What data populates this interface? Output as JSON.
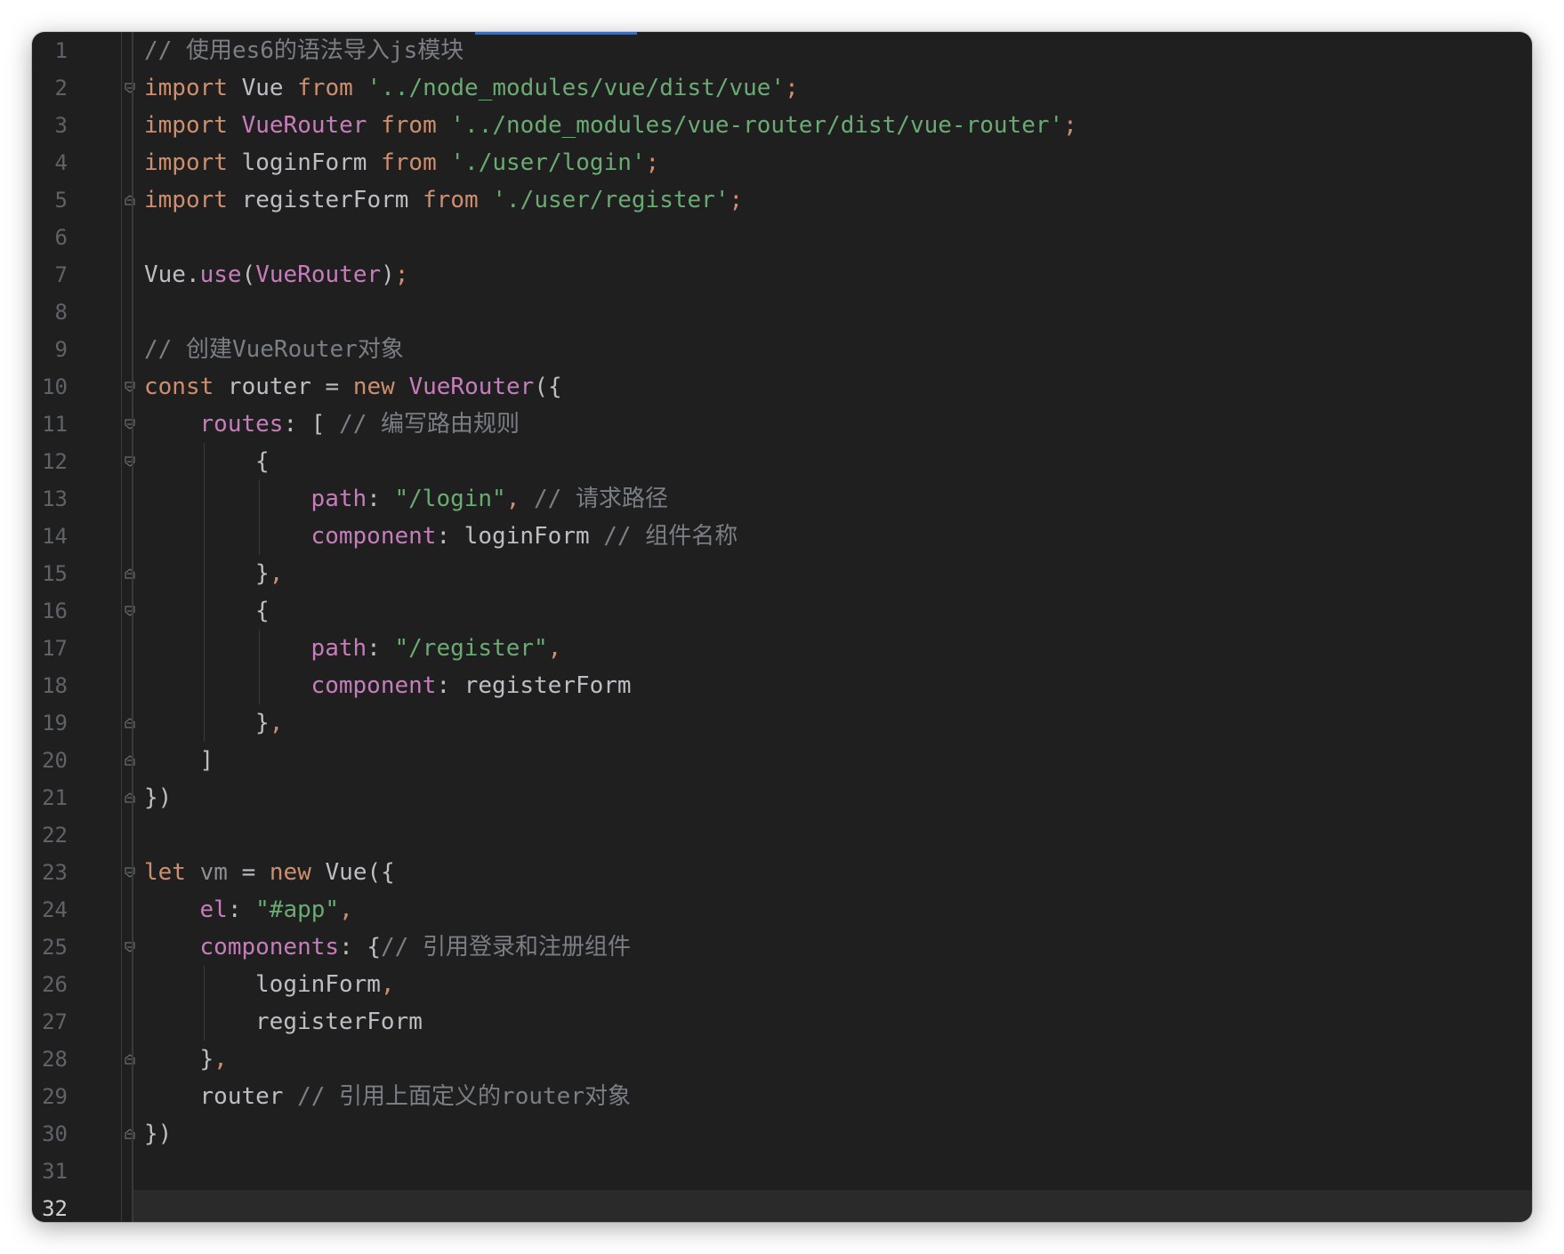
{
  "editor": {
    "current_line": 32,
    "lines": [
      {
        "n": "1",
        "indent": 0,
        "fold": "",
        "tokens": [
          [
            "cmt",
            "// 使用es6的语法导入js模块"
          ]
        ]
      },
      {
        "n": "2",
        "indent": 0,
        "fold": "open",
        "tokens": [
          [
            "kw",
            "import"
          ],
          [
            "plain",
            " Vue "
          ],
          [
            "kw",
            "from"
          ],
          [
            "plain",
            " "
          ],
          [
            "str",
            "'../node_modules/vue/dist/vue'"
          ],
          [
            "punc",
            ";"
          ]
        ]
      },
      {
        "n": "3",
        "indent": 0,
        "fold": "",
        "tokens": [
          [
            "kw",
            "import"
          ],
          [
            "plain",
            " "
          ],
          [
            "cls",
            "VueRouter"
          ],
          [
            "plain",
            " "
          ],
          [
            "kw",
            "from"
          ],
          [
            "plain",
            " "
          ],
          [
            "str",
            "'../node_modules/vue-router/dist/vue-router'"
          ],
          [
            "punc",
            ";"
          ]
        ]
      },
      {
        "n": "4",
        "indent": 0,
        "fold": "",
        "tokens": [
          [
            "kw",
            "import"
          ],
          [
            "plain",
            " loginForm "
          ],
          [
            "kw",
            "from"
          ],
          [
            "plain",
            " "
          ],
          [
            "str",
            "'./user/login'"
          ],
          [
            "punc",
            ";"
          ]
        ]
      },
      {
        "n": "5",
        "indent": 0,
        "fold": "close",
        "tokens": [
          [
            "kw",
            "import"
          ],
          [
            "plain",
            " registerForm "
          ],
          [
            "kw",
            "from"
          ],
          [
            "plain",
            " "
          ],
          [
            "str",
            "'./user/register'"
          ],
          [
            "punc",
            ";"
          ]
        ]
      },
      {
        "n": "6",
        "indent": 0,
        "fold": "",
        "tokens": []
      },
      {
        "n": "7",
        "indent": 0,
        "fold": "",
        "tokens": [
          [
            "plain",
            "Vue."
          ],
          [
            "fn",
            "use"
          ],
          [
            "plain",
            "("
          ],
          [
            "cls",
            "VueRouter"
          ],
          [
            "plain",
            ")"
          ],
          [
            "punc",
            ";"
          ]
        ]
      },
      {
        "n": "8",
        "indent": 0,
        "fold": "",
        "tokens": []
      },
      {
        "n": "9",
        "indent": 0,
        "fold": "",
        "tokens": [
          [
            "cmt",
            "// 创建VueRouter对象"
          ]
        ]
      },
      {
        "n": "10",
        "indent": 0,
        "fold": "open",
        "tokens": [
          [
            "kw",
            "const"
          ],
          [
            "plain",
            " router = "
          ],
          [
            "kw",
            "new"
          ],
          [
            "plain",
            " "
          ],
          [
            "cls",
            "VueRouter"
          ],
          [
            "plain",
            "({"
          ]
        ]
      },
      {
        "n": "11",
        "indent": 1,
        "fold": "open",
        "tokens": [
          [
            "prop",
            "routes"
          ],
          [
            "plain",
            ": [ "
          ],
          [
            "cmt",
            "// 编写路由规则"
          ]
        ]
      },
      {
        "n": "12",
        "indent": 2,
        "fold": "open",
        "tokens": [
          [
            "plain",
            "{"
          ]
        ]
      },
      {
        "n": "13",
        "indent": 3,
        "fold": "",
        "tokens": [
          [
            "prop",
            "path"
          ],
          [
            "plain",
            ": "
          ],
          [
            "str",
            "\"/login\""
          ],
          [
            "punc",
            ","
          ],
          [
            "plain",
            " "
          ],
          [
            "cmt",
            "// 请求路径"
          ]
        ]
      },
      {
        "n": "14",
        "indent": 3,
        "fold": "",
        "tokens": [
          [
            "prop",
            "component"
          ],
          [
            "plain",
            ": loginForm "
          ],
          [
            "cmt",
            "// 组件名称"
          ]
        ]
      },
      {
        "n": "15",
        "indent": 2,
        "fold": "close",
        "tokens": [
          [
            "plain",
            "}"
          ],
          [
            "punc",
            ","
          ]
        ]
      },
      {
        "n": "16",
        "indent": 2,
        "fold": "open",
        "tokens": [
          [
            "plain",
            "{"
          ]
        ]
      },
      {
        "n": "17",
        "indent": 3,
        "fold": "",
        "tokens": [
          [
            "prop",
            "path"
          ],
          [
            "plain",
            ": "
          ],
          [
            "str",
            "\"/register\""
          ],
          [
            "punc",
            ","
          ]
        ]
      },
      {
        "n": "18",
        "indent": 3,
        "fold": "",
        "tokens": [
          [
            "prop",
            "component"
          ],
          [
            "plain",
            ": registerForm"
          ]
        ]
      },
      {
        "n": "19",
        "indent": 2,
        "fold": "close",
        "tokens": [
          [
            "plain",
            "}"
          ],
          [
            "punc",
            ","
          ]
        ]
      },
      {
        "n": "20",
        "indent": 1,
        "fold": "close",
        "tokens": [
          [
            "plain",
            "]"
          ]
        ]
      },
      {
        "n": "21",
        "indent": 0,
        "fold": "close",
        "tokens": [
          [
            "plain",
            "})"
          ]
        ]
      },
      {
        "n": "22",
        "indent": 0,
        "fold": "",
        "tokens": []
      },
      {
        "n": "23",
        "indent": 0,
        "fold": "open",
        "tokens": [
          [
            "kw",
            "let"
          ],
          [
            "plain",
            " "
          ],
          [
            "dim",
            "vm"
          ],
          [
            "plain",
            " = "
          ],
          [
            "kw",
            "new"
          ],
          [
            "plain",
            " Vue({"
          ]
        ]
      },
      {
        "n": "24",
        "indent": 1,
        "fold": "",
        "tokens": [
          [
            "prop",
            "el"
          ],
          [
            "plain",
            ": "
          ],
          [
            "str",
            "\"#app\""
          ],
          [
            "punc",
            ","
          ]
        ]
      },
      {
        "n": "25",
        "indent": 1,
        "fold": "open",
        "tokens": [
          [
            "prop",
            "components"
          ],
          [
            "plain",
            ": {"
          ],
          [
            "cmt",
            "// 引用登录和注册组件"
          ]
        ]
      },
      {
        "n": "26",
        "indent": 2,
        "fold": "",
        "tokens": [
          [
            "plain",
            "loginForm"
          ],
          [
            "punc",
            ","
          ]
        ]
      },
      {
        "n": "27",
        "indent": 2,
        "fold": "",
        "tokens": [
          [
            "plain",
            "registerForm"
          ]
        ]
      },
      {
        "n": "28",
        "indent": 1,
        "fold": "close",
        "tokens": [
          [
            "plain",
            "}"
          ],
          [
            "punc",
            ","
          ]
        ]
      },
      {
        "n": "29",
        "indent": 1,
        "fold": "",
        "tokens": [
          [
            "plain",
            "router "
          ],
          [
            "cmt",
            "// 引用上面定义的router对象"
          ]
        ]
      },
      {
        "n": "30",
        "indent": 0,
        "fold": "close",
        "tokens": [
          [
            "plain",
            "})"
          ]
        ]
      },
      {
        "n": "31",
        "indent": 0,
        "fold": "",
        "tokens": []
      },
      {
        "n": "32",
        "indent": 0,
        "fold": "",
        "tokens": []
      }
    ]
  }
}
